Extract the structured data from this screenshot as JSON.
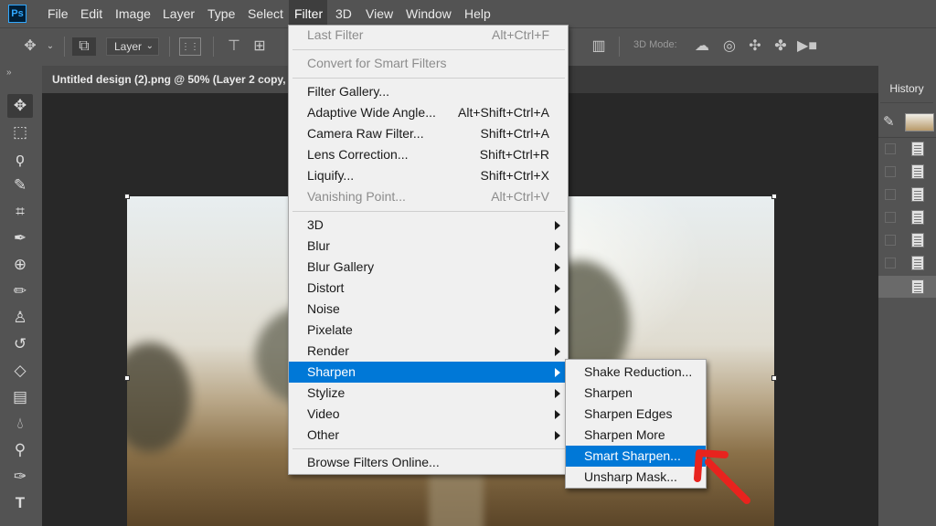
{
  "app": {
    "logo_text": "Ps"
  },
  "menubar": {
    "items": [
      "File",
      "Edit",
      "Image",
      "Layer",
      "Type",
      "Select",
      "Filter",
      "3D",
      "View",
      "Window",
      "Help"
    ],
    "active": "Filter"
  },
  "options": {
    "layer_select": "Layer",
    "mode3d_label": "3D Mode:"
  },
  "document": {
    "tab_title": "Untitled design (2).png @ 50% (Layer 2 copy, "
  },
  "history": {
    "tab_label": "History"
  },
  "filter_menu": {
    "groups": [
      [
        {
          "label": "Last Filter",
          "shortcut": "Alt+Ctrl+F",
          "disabled": true
        }
      ],
      [
        {
          "label": "Convert for Smart Filters",
          "shortcut": "",
          "disabled": true
        }
      ],
      [
        {
          "label": "Filter Gallery...",
          "shortcut": ""
        },
        {
          "label": "Adaptive Wide Angle...",
          "shortcut": "Alt+Shift+Ctrl+A"
        },
        {
          "label": "Camera Raw Filter...",
          "shortcut": "Shift+Ctrl+A"
        },
        {
          "label": "Lens Correction...",
          "shortcut": "Shift+Ctrl+R"
        },
        {
          "label": "Liquify...",
          "shortcut": "Shift+Ctrl+X"
        },
        {
          "label": "Vanishing Point...",
          "shortcut": "Alt+Ctrl+V",
          "disabled": true
        }
      ],
      [
        {
          "label": "3D",
          "submenu": true
        },
        {
          "label": "Blur",
          "submenu": true
        },
        {
          "label": "Blur Gallery",
          "submenu": true
        },
        {
          "label": "Distort",
          "submenu": true
        },
        {
          "label": "Noise",
          "submenu": true
        },
        {
          "label": "Pixelate",
          "submenu": true
        },
        {
          "label": "Render",
          "submenu": true
        },
        {
          "label": "Sharpen",
          "submenu": true,
          "highlighted": true
        },
        {
          "label": "Stylize",
          "submenu": true
        },
        {
          "label": "Video",
          "submenu": true
        },
        {
          "label": "Other",
          "submenu": true
        }
      ],
      [
        {
          "label": "Browse Filters Online...",
          "shortcut": ""
        }
      ]
    ]
  },
  "sharpen_submenu": {
    "items": [
      {
        "label": "Shake Reduction..."
      },
      {
        "label": "Sharpen"
      },
      {
        "label": "Sharpen Edges"
      },
      {
        "label": "Sharpen More"
      },
      {
        "label": "Smart Sharpen...",
        "highlighted": true
      },
      {
        "label": "Unsharp Mask..."
      }
    ]
  },
  "colors": {
    "highlight": "#0078d7",
    "annotation_arrow": "#e8231e"
  }
}
